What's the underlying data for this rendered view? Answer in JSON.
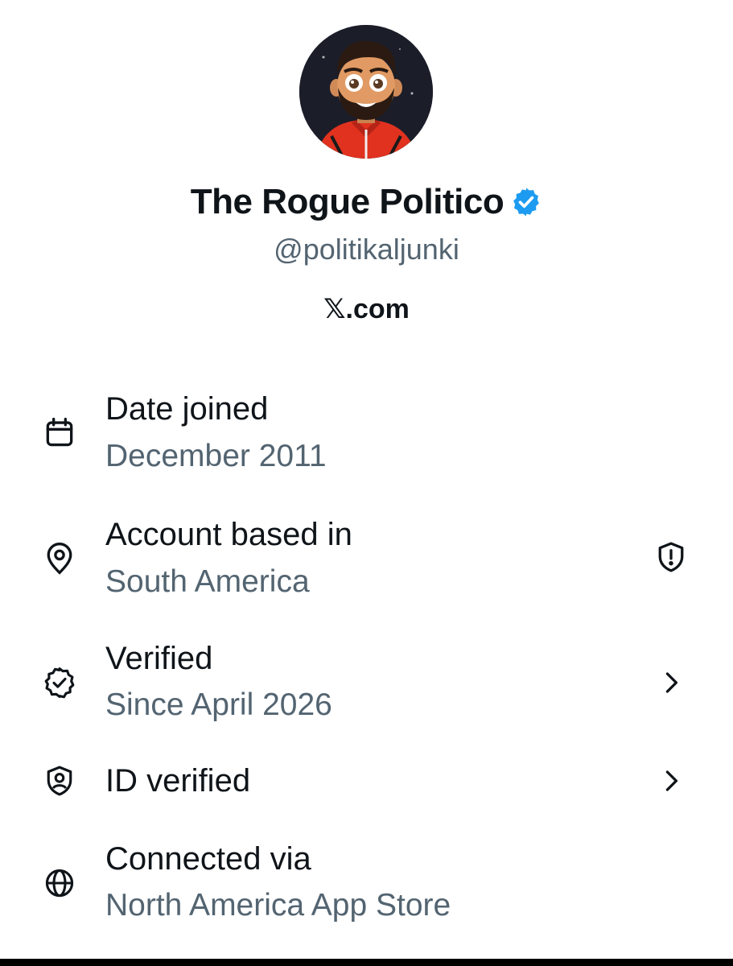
{
  "profile": {
    "display_name": "The Rogue Politico",
    "handle": "@politikaljunki",
    "website": "𝕏.com",
    "verified_badge_icon": "verified-badge-icon",
    "badge_color": "#1d9bf0"
  },
  "details": {
    "date_joined": {
      "label": "Date joined",
      "value": "December 2011",
      "icon": "calendar-icon"
    },
    "based_in": {
      "label": "Account based in",
      "value": "South America",
      "icon": "location-pin-icon",
      "trailing_icon": "shield-alert-icon"
    },
    "verified": {
      "label": "Verified",
      "value": "Since April 2026",
      "icon": "verified-check-icon",
      "trailing_icon": "chevron-right-icon"
    },
    "id_verified": {
      "label": "ID verified",
      "icon": "id-shield-icon",
      "trailing_icon": "chevron-right-icon"
    },
    "connected_via": {
      "label": "Connected via",
      "value": "North America App Store",
      "icon": "globe-icon"
    }
  },
  "colors": {
    "text_primary": "#0f1419",
    "text_secondary": "#536471",
    "accent": "#1d9bf0"
  }
}
